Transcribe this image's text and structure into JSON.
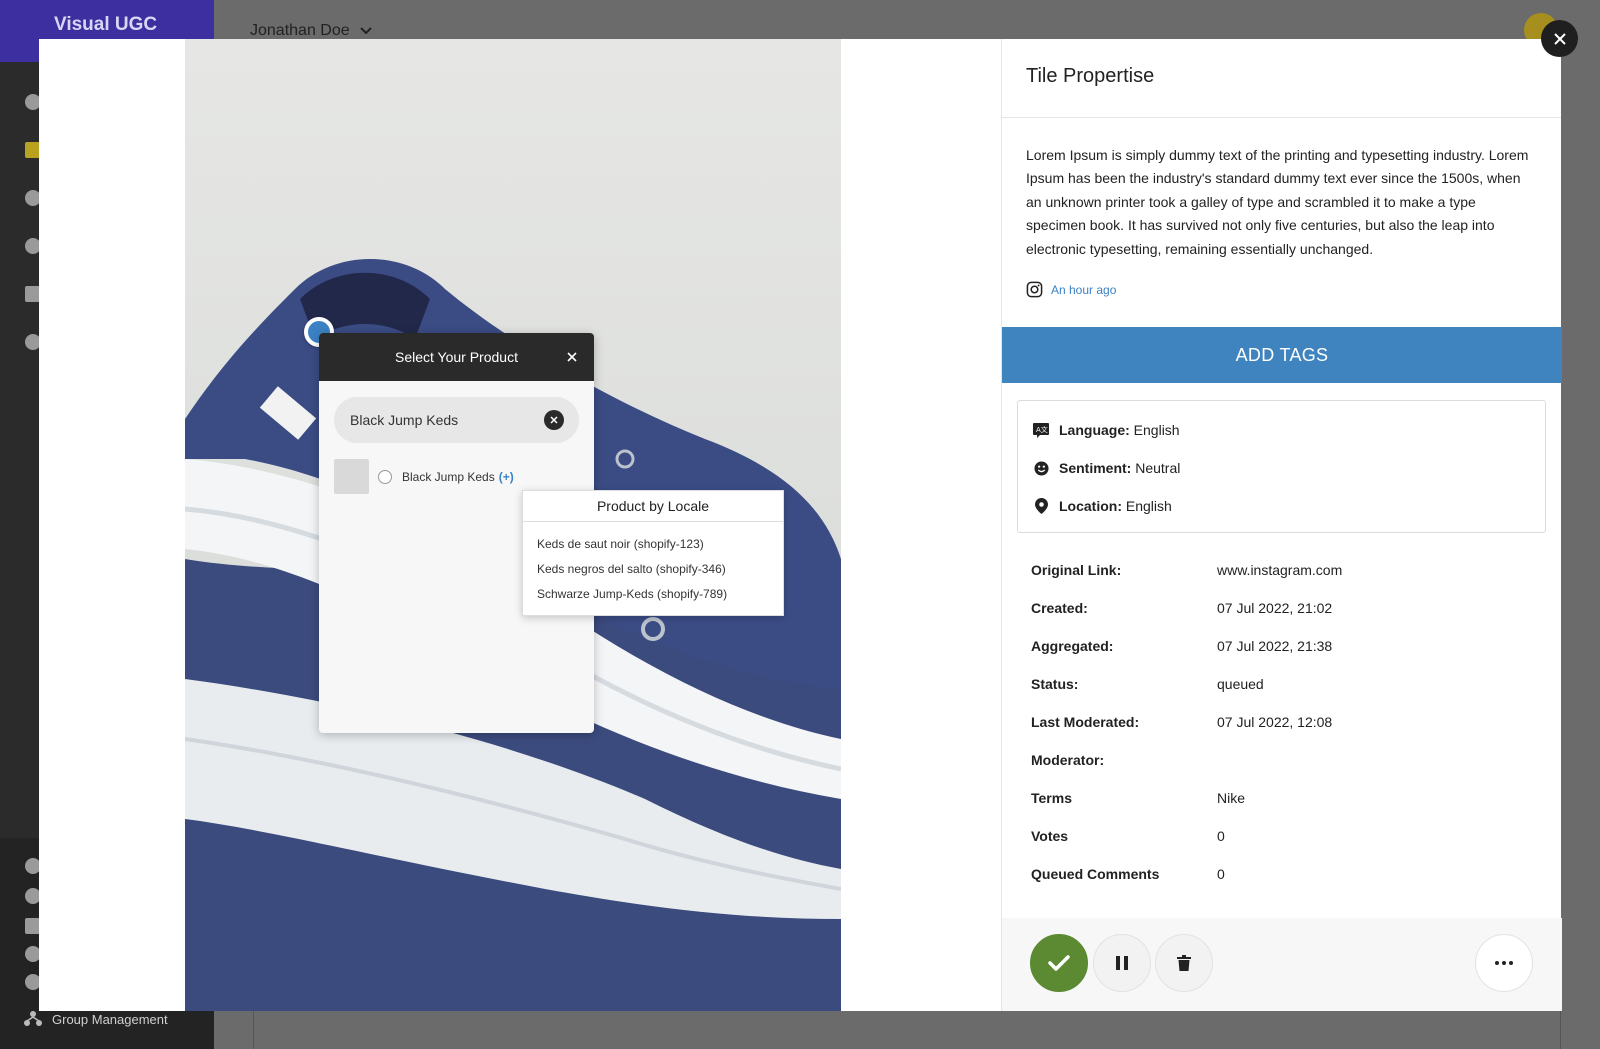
{
  "app": {
    "logo_text": "Visual UGC",
    "user_name": "Jonathan Doe",
    "sidebar_bottom_item": "Group Management"
  },
  "modal": {
    "close_icon": "close-icon"
  },
  "product_selector": {
    "title": "Select Your Product",
    "search_value": "Black Jump Keds",
    "result_name": "Black Jump Keds",
    "result_add": "(+)"
  },
  "locale_popup": {
    "title": "Product by Locale",
    "items": [
      "Keds de saut noir (shopify-123)",
      "Keds negros del salto (shopify-346)",
      "Schwarze Jump-Keds (shopify-789)"
    ]
  },
  "details": {
    "title": "Tile Propertise",
    "description": "Lorem Ipsum is simply dummy text of the printing and typesetting industry. Lorem Ipsum has been the industry's standard dummy text ever since the 1500s, when an unknown printer took a galley of type and scrambled it to make a type specimen book. It has survived not only five centuries, but also the leap into electronic typesetting, remaining essentially unchanged.",
    "posted_time": "An hour ago",
    "add_tags_label": "ADD TAGS",
    "tags": {
      "language_label": "Language:",
      "language_value": "English",
      "sentiment_label": "Sentiment:",
      "sentiment_value": "Neutral",
      "location_label": "Location:",
      "location_value": "English"
    },
    "info": [
      {
        "key": "Original Link:",
        "value": "www.instagram.com"
      },
      {
        "key": "Created:",
        "value": "07 Jul 2022, 21:02"
      },
      {
        "key": "Aggregated:",
        "value": "07 Jul 2022, 21:38"
      },
      {
        "key": "Status:",
        "value": "queued"
      },
      {
        "key": "Last Moderated:",
        "value": "07 Jul 2022, 12:08"
      },
      {
        "key": "Moderator:",
        "value": ""
      },
      {
        "key": "Terms",
        "value": "Nike"
      },
      {
        "key": "Votes",
        "value": "0"
      },
      {
        "key": "Queued Comments",
        "value": "0"
      }
    ]
  },
  "colors": {
    "accent_blue": "#3f83bf",
    "approve_green": "#5b8a32",
    "logo_purple": "#3d2fa0"
  }
}
